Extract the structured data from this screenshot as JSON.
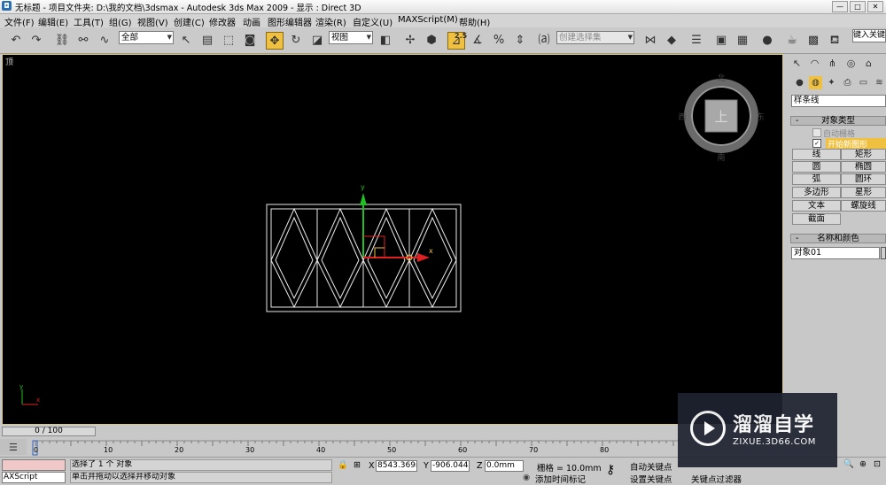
{
  "window": {
    "title": "无标题    - 项目文件夹: D:\\我的文档\\3dsmax     - Autodesk 3ds Max  2009      - 显示 : Direct 3D",
    "minimize": "—",
    "restore": "□",
    "close": "✕"
  },
  "menu": [
    "文件(F)",
    "编辑(E)",
    "工具(T)",
    "组(G)",
    "视图(V)",
    "创建(C)",
    "修改器",
    "动画",
    "图形编辑器",
    "渲染(R)",
    "自定义(U)",
    "MAXScript(M)",
    "帮助(H)"
  ],
  "toolbar": {
    "selection_filter": "全部",
    "reference_coord": "视图",
    "snap_label": "2.5",
    "named_selection_placeholder": "创建选择集",
    "search_placeholder": "键入关键"
  },
  "viewport": {
    "label": "顶",
    "viewcube": {
      "face": "上",
      "north": "北",
      "south": "南",
      "east": "东",
      "west": "西"
    },
    "gizmo": {
      "x": "x",
      "y": "y"
    },
    "axis": {
      "x": "x",
      "y": "y"
    }
  },
  "command_panel": {
    "category_dropdown": "样条线",
    "object_type_title": "对象类型",
    "auto_grid_label": "自动栅格",
    "start_new_shape_label": "开始新图形",
    "start_new_shape_checked": true,
    "buttons": [
      "线",
      "矩形",
      "圆",
      "椭圆",
      "弧",
      "圆环",
      "多边形",
      "星形",
      "文本",
      "螺旋线",
      "截面"
    ],
    "name_color_title": "名称和颜色",
    "object_name": "对象01"
  },
  "timeline": {
    "frame_display": "0 / 100",
    "ticks": [
      "0",
      "10",
      "20",
      "30",
      "40",
      "50",
      "60",
      "70",
      "80"
    ]
  },
  "status": {
    "maxscript": "AXScript",
    "selection_text": "选择了 1 个 对象",
    "prompt_text": "单击并拖动以选择并移动对象",
    "x_label": "X",
    "x_value": "8543.369m",
    "y_label": "Y",
    "y_value": "-906.044m",
    "z_label": "Z",
    "z_value": "0.0mm",
    "grid_text": "栅格 = 10.0mm",
    "add_time_tag": "添加时间标记",
    "auto_key": "自动关键点",
    "set_key": "设置关键点",
    "key_filters": "关键点过滤器"
  },
  "watermark": {
    "title": "溜溜自学",
    "url": "ZIXUE.3D66.COM"
  },
  "colors": {
    "viewport_bg": "#000000",
    "accent": "#f0c040",
    "gizmo_x": "#e02020",
    "gizmo_y": "#20c020"
  }
}
